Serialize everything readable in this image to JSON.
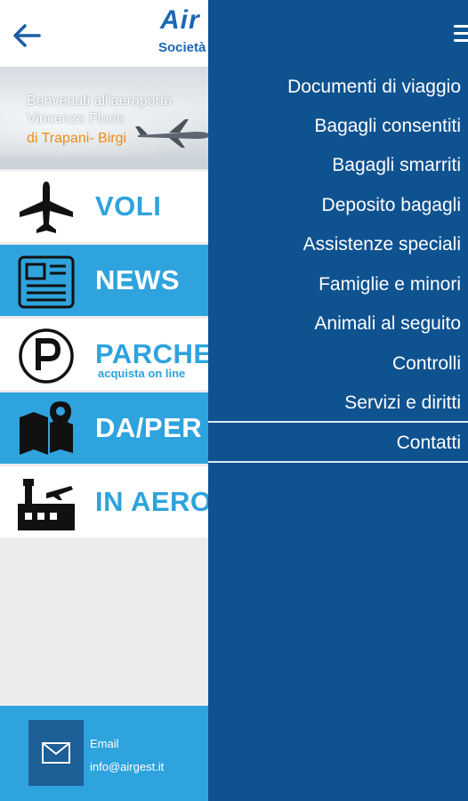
{
  "header": {
    "logo_text": "Air",
    "logo_sub": "Società"
  },
  "banner": {
    "line1": "Benvenuti all'aeroporto",
    "line2": "Vincenzo Florio",
    "line3": "di Trapani- Birgi"
  },
  "tiles": [
    {
      "label": "VOLI",
      "icon": "airplane-icon"
    },
    {
      "label": "NEWS",
      "icon": "newspaper-icon"
    },
    {
      "label": "PARCHE",
      "sub": "acquista on line",
      "icon": "parking-icon"
    },
    {
      "label": "DA/PER",
      "icon": "map-pin-icon"
    },
    {
      "label": "IN AERO",
      "icon": "airport-tower-icon"
    }
  ],
  "footer": {
    "email_label": "Email",
    "email_value": "info@airgest.it"
  },
  "drawer": {
    "items": [
      "Documenti di viaggio",
      "Bagagli consentiti",
      "Bagagli smarriti",
      "Deposito bagagli",
      "Assistenze speciali",
      "Famiglie e minori",
      "Animali al seguito",
      "Controlli",
      "Servizi e diritti",
      "Contatti"
    ]
  },
  "colors": {
    "accent_blue": "#2ea3dd",
    "drawer_blue": "#0f5290",
    "logo_blue": "#1b66b5",
    "banner_orange": "#f08a12"
  }
}
